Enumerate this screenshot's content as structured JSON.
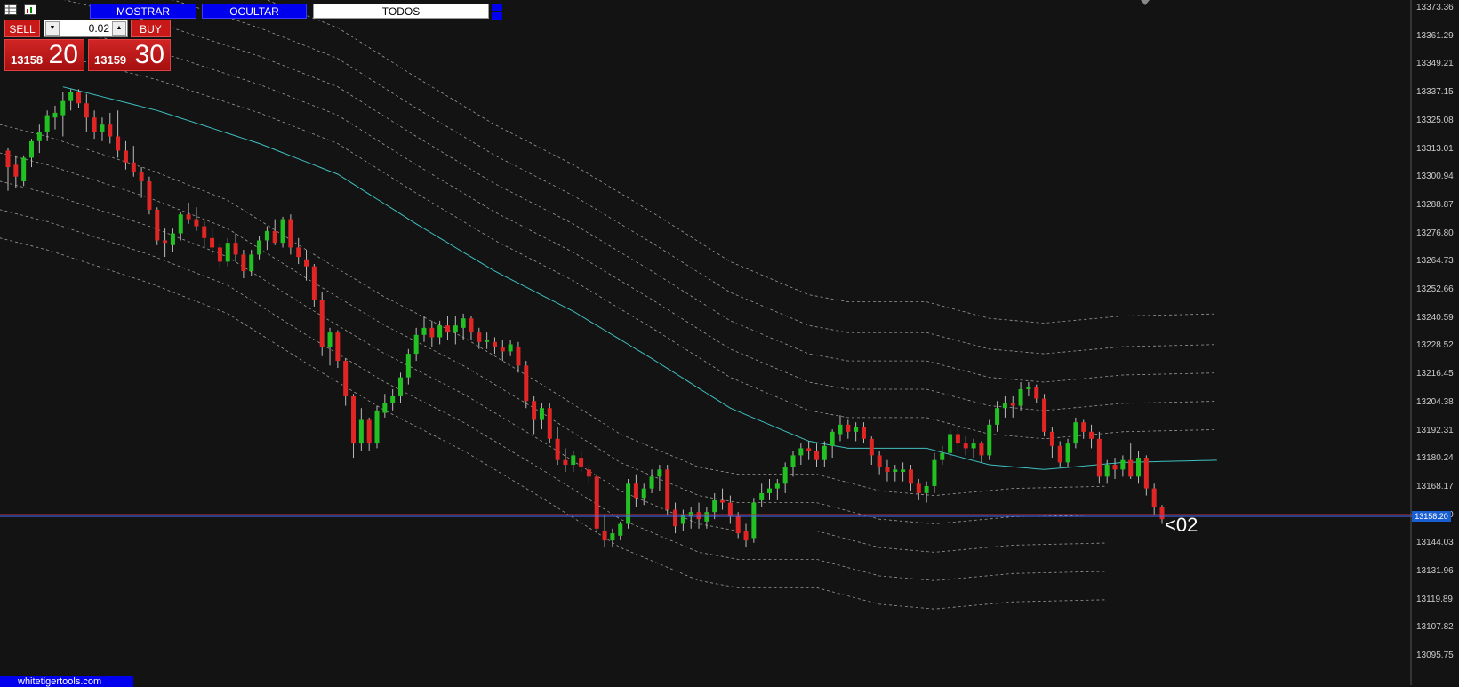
{
  "toolbar": {
    "icons": [
      "table-icon",
      "chart-icon"
    ],
    "buttons": [
      {
        "id": "mostrar",
        "label": "MOSTRAR"
      },
      {
        "id": "ocultar",
        "label": "OCULTAR"
      },
      {
        "id": "todos",
        "label": "TODOS"
      }
    ]
  },
  "trade_panel": {
    "sell_label": "SELL",
    "buy_label": "BUY",
    "lot_value": "0.02",
    "sell_price_small": "13158",
    "sell_price_big": "20",
    "buy_price_small": "13159",
    "buy_price_big": "30"
  },
  "price_axis": {
    "labels": [
      "13373.36",
      "13361.29",
      "13349.21",
      "13337.15",
      "13325.08",
      "13313.01",
      "13300.94",
      "13288.87",
      "13276.80",
      "13264.73",
      "13252.66",
      "13240.59",
      "13228.52",
      "13216.45",
      "13204.38",
      "13192.31",
      "13180.24",
      "13168.17",
      "13156.10",
      "13144.03",
      "13131.96",
      "13119.89",
      "13107.82",
      "13095.75"
    ],
    "current_price": "13158.20"
  },
  "annotation_label": "<02",
  "watermark": "whitetigertools.com",
  "colors": {
    "background": "#131313",
    "bull": "#22c022",
    "bear": "#e02525",
    "ma": "#3fbfbf",
    "bands": "#9a9a9a",
    "price_line": "#4d6bff",
    "button_blue": "#0000ee",
    "panel_red": "#c81818"
  },
  "chart_data": {
    "type": "candlestick",
    "ylim": [
      13095.75,
      13373.36
    ],
    "candles": [
      [
        13313,
        13314,
        13296,
        13306
      ],
      [
        13307,
        13311,
        13297,
        13302
      ],
      [
        13300,
        13311,
        13298,
        13310
      ],
      [
        13310,
        13318,
        13306,
        13317
      ],
      [
        13317,
        13324,
        13312,
        13321
      ],
      [
        13321,
        13330,
        13317,
        13328
      ],
      [
        13327,
        13332,
        13322,
        13329
      ],
      [
        13328,
        13338,
        13319,
        13334
      ],
      [
        13334,
        13339,
        13330,
        13338
      ],
      [
        13338,
        13339,
        13331,
        13333
      ],
      [
        13333,
        13337,
        13321,
        13327
      ],
      [
        13327,
        13330,
        13318,
        13321
      ],
      [
        13321,
        13327,
        13317,
        13324
      ],
      [
        13324,
        13329,
        13316,
        13319
      ],
      [
        13319,
        13330,
        13310,
        13313
      ],
      [
        13313,
        13317,
        13305,
        13308
      ],
      [
        13308,
        13315,
        13302,
        13304
      ],
      [
        13304,
        13306,
        13293,
        13300
      ],
      [
        13300,
        13302,
        13286,
        13288
      ],
      [
        13288,
        13289,
        13273,
        13275
      ],
      [
        13275,
        13280,
        13268,
        13274
      ],
      [
        13273,
        13280,
        13270,
        13278
      ],
      [
        13278,
        13287,
        13275,
        13286
      ],
      [
        13286,
        13291,
        13282,
        13284
      ],
      [
        13284,
        13289,
        13279,
        13281
      ],
      [
        13281,
        13283,
        13272,
        13276
      ],
      [
        13276,
        13280,
        13269,
        13272
      ],
      [
        13272,
        13274,
        13263,
        13266
      ],
      [
        13266,
        13276,
        13264,
        13274
      ],
      [
        13274,
        13278,
        13266,
        13269
      ],
      [
        13269,
        13271,
        13259,
        13262
      ],
      [
        13262,
        13271,
        13260,
        13269
      ],
      [
        13269,
        13277,
        13267,
        13275
      ],
      [
        13275,
        13281,
        13271,
        13279
      ],
      [
        13279,
        13284,
        13273,
        13274
      ],
      [
        13274,
        13285,
        13272,
        13284
      ],
      [
        13284,
        13286,
        13269,
        13272
      ],
      [
        13272,
        13276,
        13265,
        13268
      ],
      [
        13267,
        13271,
        13258,
        13264
      ],
      [
        13264,
        13265,
        13247,
        13250
      ],
      [
        13250,
        13253,
        13226,
        13230
      ],
      [
        13230,
        13238,
        13222,
        13236
      ],
      [
        13236,
        13237,
        13221,
        13224
      ],
      [
        13224,
        13225,
        13205,
        13209
      ],
      [
        13209,
        13210,
        13183,
        13189
      ],
      [
        13189,
        13204,
        13186,
        13199
      ],
      [
        13199,
        13200,
        13186,
        13189
      ],
      [
        13189,
        13205,
        13187,
        13203
      ],
      [
        13202,
        13210,
        13200,
        13206
      ],
      [
        13206,
        13212,
        13203,
        13209
      ],
      [
        13209,
        13219,
        13206,
        13217
      ],
      [
        13217,
        13229,
        13214,
        13227
      ],
      [
        13227,
        13238,
        13224,
        13235
      ],
      [
        13235,
        13243,
        13232,
        13238
      ],
      [
        13238,
        13241,
        13230,
        13234
      ],
      [
        13234,
        13241,
        13231,
        13239
      ],
      [
        13239,
        13243,
        13233,
        13236
      ],
      [
        13236,
        13243,
        13231,
        13239
      ],
      [
        13238,
        13244,
        13233,
        13242
      ],
      [
        13242,
        13243,
        13233,
        13236
      ],
      [
        13236,
        13238,
        13229,
        13232
      ],
      [
        13232,
        13236,
        13229,
        13233
      ],
      [
        13232,
        13234,
        13227,
        13230
      ],
      [
        13230,
        13233,
        13224,
        13228
      ],
      [
        13228,
        13233,
        13226,
        13231
      ],
      [
        13230,
        13232,
        13219,
        13222
      ],
      [
        13222,
        13224,
        13204,
        13207
      ],
      [
        13207,
        13209,
        13193,
        13199
      ],
      [
        13199,
        13206,
        13195,
        13204
      ],
      [
        13204,
        13206,
        13189,
        13191
      ],
      [
        13191,
        13196,
        13180,
        13182
      ],
      [
        13182,
        13187,
        13177,
        13180
      ],
      [
        13180,
        13186,
        13177,
        13184
      ],
      [
        13183,
        13186,
        13177,
        13179
      ],
      [
        13178,
        13180,
        13172,
        13175
      ],
      [
        13175,
        13176,
        13151,
        13153
      ],
      [
        13152,
        13159,
        13145,
        13148
      ],
      [
        13148,
        13153,
        13145,
        13151
      ],
      [
        13150,
        13156,
        13148,
        13155
      ],
      [
        13155,
        13174,
        13153,
        13172
      ],
      [
        13172,
        13176,
        13162,
        13166
      ],
      [
        13166,
        13172,
        13163,
        13170
      ],
      [
        13170,
        13178,
        13168,
        13175
      ],
      [
        13175,
        13180,
        13169,
        13178
      ],
      [
        13178,
        13180,
        13159,
        13161
      ],
      [
        13161,
        13164,
        13151,
        13154
      ],
      [
        13155,
        13161,
        13152,
        13159
      ],
      [
        13158,
        13162,
        13153,
        13160
      ],
      [
        13160,
        13164,
        13153,
        13157
      ],
      [
        13156,
        13162,
        13153,
        13160
      ],
      [
        13160,
        13168,
        13157,
        13165
      ],
      [
        13165,
        13170,
        13161,
        13164
      ],
      [
        13164,
        13167,
        13155,
        13158
      ],
      [
        13158,
        13160,
        13149,
        13151
      ],
      [
        13152,
        13155,
        13145,
        13148
      ],
      [
        13149,
        13166,
        13147,
        13164
      ],
      [
        13165,
        13172,
        13162,
        13168
      ],
      [
        13168,
        13174,
        13165,
        13170
      ],
      [
        13170,
        13174,
        13165,
        13172
      ],
      [
        13172,
        13181,
        13168,
        13179
      ],
      [
        13179,
        13186,
        13175,
        13184
      ],
      [
        13184,
        13189,
        13180,
        13187
      ],
      [
        13187,
        13190,
        13182,
        13186
      ],
      [
        13186,
        13189,
        13179,
        13182
      ],
      [
        13182,
        13190,
        13179,
        13188
      ],
      [
        13188,
        13195,
        13183,
        13194
      ],
      [
        13193,
        13201,
        13190,
        13197
      ],
      [
        13197,
        13199,
        13191,
        13194
      ],
      [
        13194,
        13198,
        13190,
        13196
      ],
      [
        13196,
        13198,
        13189,
        13191
      ],
      [
        13191,
        13192,
        13180,
        13184
      ],
      [
        13184,
        13186,
        13176,
        13179
      ],
      [
        13179,
        13182,
        13173,
        13177
      ],
      [
        13177,
        13180,
        13173,
        13178
      ],
      [
        13177,
        13181,
        13173,
        13178
      ],
      [
        13178,
        13180,
        13169,
        13172
      ],
      [
        13172,
        13174,
        13165,
        13168
      ],
      [
        13168,
        13173,
        13164,
        13171
      ],
      [
        13171,
        13185,
        13168,
        13182
      ],
      [
        13182,
        13188,
        13180,
        13185
      ],
      [
        13185,
        13195,
        13182,
        13193
      ],
      [
        13193,
        13196,
        13186,
        13189
      ],
      [
        13189,
        13192,
        13184,
        13187
      ],
      [
        13187,
        13191,
        13183,
        13189
      ],
      [
        13189,
        13190,
        13181,
        13184
      ],
      [
        13184,
        13199,
        13182,
        13197
      ],
      [
        13197,
        13207,
        13194,
        13204
      ],
      [
        13204,
        13209,
        13200,
        13206
      ],
      [
        13206,
        13209,
        13200,
        13205
      ],
      [
        13205,
        13215,
        13203,
        13212
      ],
      [
        13212,
        13215,
        13209,
        13213
      ],
      [
        13213,
        13214,
        13206,
        13208
      ],
      [
        13208,
        13210,
        13192,
        13194
      ],
      [
        13194,
        13196,
        13183,
        13188
      ],
      [
        13188,
        13190,
        13179,
        13181
      ],
      [
        13181,
        13191,
        13179,
        13189
      ],
      [
        13189,
        13200,
        13187,
        13198
      ],
      [
        13198,
        13199,
        13191,
        13194
      ],
      [
        13194,
        13197,
        13187,
        13191
      ],
      [
        13191,
        13194,
        13172,
        13175
      ],
      [
        13175,
        13182,
        13172,
        13180
      ],
      [
        13180,
        13183,
        13174,
        13178
      ],
      [
        13178,
        13184,
        13175,
        13182
      ],
      [
        13182,
        13189,
        13174,
        13175
      ],
      [
        13175,
        13186,
        13172,
        13183
      ],
      [
        13183,
        13184,
        13167,
        13170
      ],
      [
        13170,
        13172,
        13159,
        13162
      ],
      [
        13162,
        13163,
        13155,
        13157
      ]
    ],
    "ma": [
      [
        0,
        13340
      ],
      [
        12,
        13330
      ],
      [
        25,
        13316
      ],
      [
        35,
        13303
      ],
      [
        45,
        13282
      ],
      [
        55,
        13262
      ],
      [
        65,
        13245
      ],
      [
        75,
        13225
      ],
      [
        85,
        13204
      ],
      [
        95,
        13190
      ],
      [
        100,
        13187
      ],
      [
        110,
        13187
      ],
      [
        118,
        13180
      ],
      [
        125,
        13178
      ],
      [
        135,
        13181
      ],
      [
        148,
        13182
      ]
    ],
    "band_offsets": [
      -59,
      -47,
      -35,
      -23,
      -11,
      13,
      25,
      37,
      49,
      62
    ],
    "current_price": 13158.2
  }
}
